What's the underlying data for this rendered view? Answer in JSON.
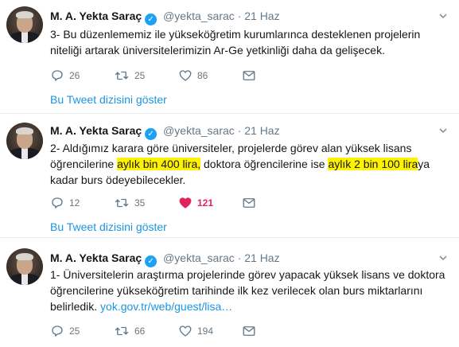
{
  "tweets": [
    {
      "author": "M. A. Yekta Saraç",
      "handle": "@yekta_sarac",
      "separator": "·",
      "date": "21 Haz",
      "text_parts": [
        "3- Bu düzenlememiz ile yükseköğretim kurumlarınca desteklenen projelerin niteliği artarak üniversitelerimizin Ar-Ge yetkinliği daha da gelişecek."
      ],
      "replies": "26",
      "retweets": "25",
      "likes": "86",
      "thread_link": "Bu Tweet dizisini göster"
    },
    {
      "author": "M. A. Yekta Saraç",
      "handle": "@yekta_sarac",
      "separator": "·",
      "date": "21 Haz",
      "text_parts": [
        "2- Aldığımız karara göre üniversiteler, projelerde görev alan yüksek lisans öğrencilerine ",
        "aylık bin 400 lira,",
        " doktora öğrencilerine ise ",
        "aylık 2 bin 100 lira",
        "ya kadar burs ödeyebilecekler."
      ],
      "replies": "12",
      "retweets": "35",
      "likes": "121",
      "thread_link": "Bu Tweet dizisini göster"
    },
    {
      "author": "M. A. Yekta Saraç",
      "handle": "@yekta_sarac",
      "separator": "·",
      "date": "21 Haz",
      "text_parts": [
        "1- Üniversitelerin araştırma projelerinde görev yapacak yüksek lisans ve doktora öğrencilerine yükseköğretim tarihinde ilk kez verilecek olan burs miktarlarını belirledik. ",
        "yok.gov.tr/web/guest/lisa…"
      ],
      "replies": "25",
      "retweets": "66",
      "likes": "194"
    }
  ],
  "colors": {
    "text": "#14171a",
    "muted": "#657786",
    "link": "#1b95e0",
    "verified": "#1da1f2",
    "like_active": "#e0245e",
    "highlight": "#fff200"
  },
  "icons": [
    "reply-icon",
    "retweet-icon",
    "like-icon",
    "dm-icon",
    "chevron-down-icon",
    "verified-icon"
  ]
}
